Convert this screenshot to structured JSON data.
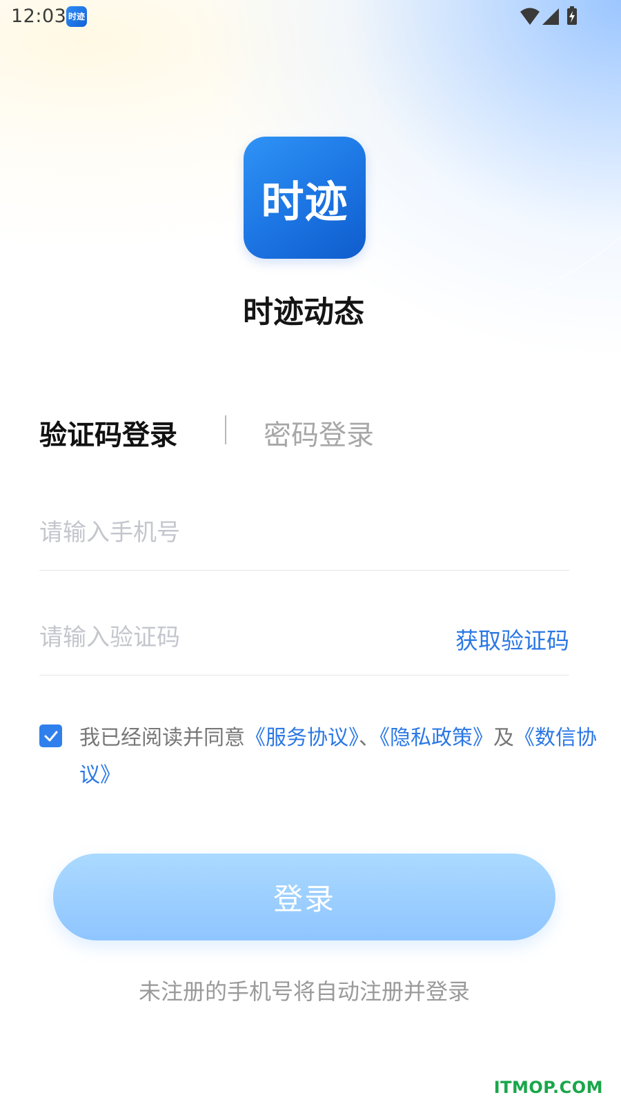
{
  "status_bar": {
    "time": "12:03",
    "app_icon_text": "时迹"
  },
  "logo": {
    "text": "时迹"
  },
  "app_name": "时迹动态",
  "tabs": {
    "active": "验证码登录",
    "inactive": "密码登录"
  },
  "phone_input": {
    "placeholder": "请输入手机号",
    "value": ""
  },
  "code_input": {
    "placeholder": "请输入验证码",
    "value": ""
  },
  "get_code_label": "获取验证码",
  "agreement": {
    "checked": true,
    "prefix": "我已经阅读并同意",
    "service": "《服务协议》",
    "sep1": "、",
    "privacy": "《隐私政策》",
    "sep2": "及",
    "data": "《数信协议》"
  },
  "login_button_label": "登录",
  "register_note": "未注册的手机号将自动注册并登录",
  "watermark": "ITMOP.COM",
  "colors": {
    "accent": "#2b78e4",
    "button": "#9ccfff",
    "logo": "#1d77e4"
  }
}
